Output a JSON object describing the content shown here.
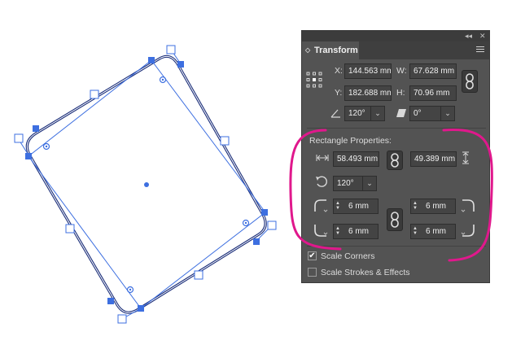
{
  "panel": {
    "collapse_icon": "double-chevron-icon",
    "close_icon": "close-icon",
    "tab_title": "Transform",
    "menu_icon": "panel-menu-icon",
    "x_label": "X:",
    "x_value": "144.563 mm",
    "y_label": "Y:",
    "y_value": "182.688 mm",
    "w_label": "W:",
    "w_value": "67.628 mm",
    "h_label": "H:",
    "h_value": "70.96 mm",
    "rotate_value": "120°",
    "shear_value": "0°",
    "rect_props_label": "Rectangle Properties:",
    "rect_width": "58.493 mm",
    "rect_height": "49.389 mm",
    "rect_rotate": "120°",
    "corner_tl": "6 mm",
    "corner_tr": "6 mm",
    "corner_bl": "6 mm",
    "corner_br": "6 mm",
    "scale_corners_label": "Scale Corners",
    "scale_corners_checked": true,
    "scale_strokes_label": "Scale Strokes & Effects",
    "scale_strokes_checked": false
  },
  "colors": {
    "selection": "#3d6fe0",
    "shape_stroke": "#1c2f7a",
    "annotation": "#e0188c",
    "panel_bg": "#535353"
  }
}
